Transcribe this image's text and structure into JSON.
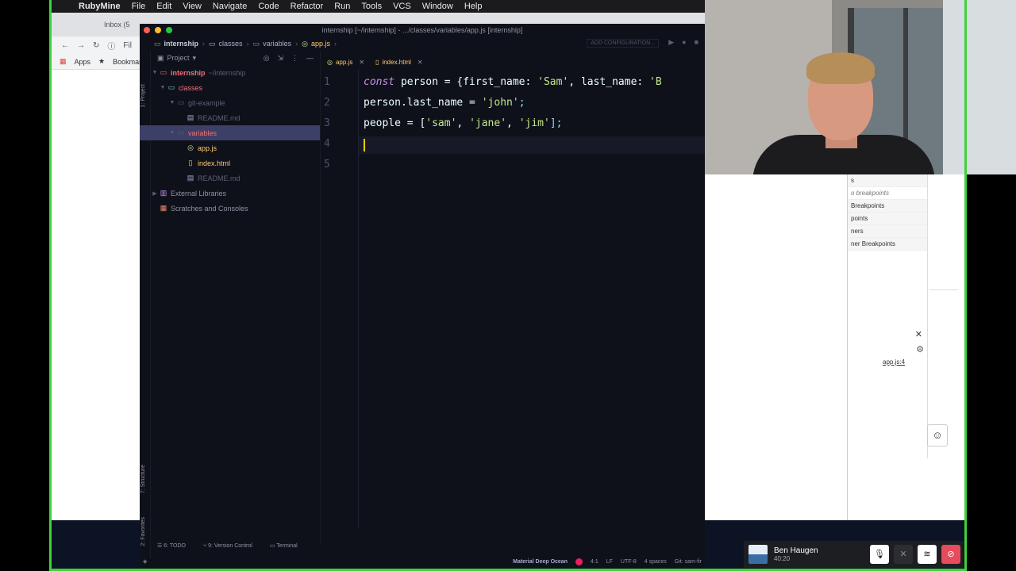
{
  "menubar": {
    "app_name": "RubyMine",
    "items": [
      "File",
      "Edit",
      "View",
      "Navigate",
      "Code",
      "Refactor",
      "Run",
      "Tools",
      "VCS",
      "Window",
      "Help"
    ]
  },
  "browser": {
    "tab_text": "Inbox (5",
    "address_prefix": "Fil",
    "bookmarks": [
      "Apps",
      "Bookmarl"
    ]
  },
  "ide": {
    "title": "internship [~/internship] - .../classes/variables/app.js [internship]",
    "breadcrumb": [
      "internship",
      "classes",
      "variables",
      "app.js"
    ],
    "add_configuration": "ADD CONFIGURATION...",
    "left_strip": {
      "project": "1: Project",
      "structure": "7: Structure",
      "favorites": "2: Favorites"
    },
    "project_panel": {
      "header": "Project",
      "tree": [
        {
          "label": "internship",
          "suffix": "~/internship",
          "level": 0
        },
        {
          "label": "classes",
          "level": 1
        },
        {
          "label": "git-example",
          "level": 2
        },
        {
          "label": "README.md",
          "level": 3
        },
        {
          "label": "variables",
          "level": 2
        },
        {
          "label": "app.js",
          "level": 3
        },
        {
          "label": "index.html",
          "level": 3
        },
        {
          "label": "README.md",
          "level": 3
        },
        {
          "label": "External Libraries",
          "level": 0
        },
        {
          "label": "Scratches and Consoles",
          "level": 0
        }
      ]
    },
    "tabs": [
      {
        "label": "app.js",
        "active": true
      },
      {
        "label": "index.html",
        "active": false
      }
    ],
    "line_numbers": [
      "1",
      "2",
      "3",
      "4",
      "5"
    ],
    "code": {
      "l1_kw": "const",
      "l1_a": " person = {first_name: ",
      "l1_s1": "'Sam'",
      "l1_b": ", last_name: ",
      "l1_s2": "'B",
      "l2_a": "person.last_name = ",
      "l2_s": "'john'",
      "l2_b": ";",
      "l3_a": "people = [",
      "l3_s1": "'sam'",
      "l3_c1": ", ",
      "l3_s2": "'jane'",
      "l3_c2": ", ",
      "l3_s3": "'jim'",
      "l3_b": "];"
    },
    "bottom_tools": [
      "6: TODO",
      "9: Version Control",
      "Terminal"
    ],
    "status": {
      "theme": "Material Deep Ocean",
      "position": "4:1",
      "line_sep": "LF",
      "encoding": "UTF-8",
      "indent": "4 spaces",
      "git": "Git: sam-fir"
    }
  },
  "devtools": {
    "rows": [
      "s",
      "o breakpoints",
      "Breakpoints",
      "points",
      "ners",
      "ner Breakpoints"
    ],
    "link": "app.js:4"
  },
  "participant": {
    "name": "Ben Haugen",
    "time": "40:20"
  },
  "colors": {
    "border": "#3fd13a",
    "editor_bg": "#0f111a",
    "keyword": "#c792ea",
    "string": "#c3e88d",
    "selected_folder": "#f07178"
  }
}
